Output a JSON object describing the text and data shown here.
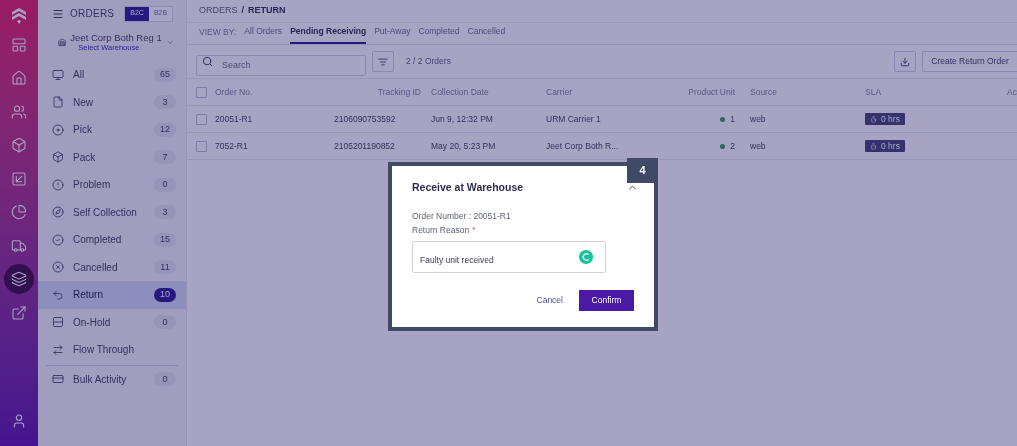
{
  "rail_items": [
    {
      "kind": "logo",
      "selected": false
    },
    {
      "kind": "layout",
      "selected": false
    },
    {
      "kind": "home",
      "selected": false
    },
    {
      "kind": "users",
      "selected": false
    },
    {
      "kind": "box",
      "selected": false
    },
    {
      "kind": "inbound",
      "selected": false
    },
    {
      "kind": "chart",
      "selected": false
    },
    {
      "kind": "truck",
      "selected": false
    },
    {
      "kind": "layers",
      "selected": true
    },
    {
      "kind": "external",
      "selected": false
    },
    {
      "kind": "user",
      "selected": false
    }
  ],
  "sidebar": {
    "title": "ORDERS",
    "segments": [
      {
        "label": "B2C",
        "selected": true
      },
      {
        "label": "B2B",
        "selected": false
      }
    ],
    "warehouse": {
      "name": "Jeet Corp Both Reg 1",
      "hint": "Select Warehouse"
    },
    "items": [
      {
        "label": "All",
        "count": "65",
        "selected": false
      },
      {
        "label": "New",
        "count": "3",
        "selected": false
      },
      {
        "label": "Pick",
        "count": "12",
        "selected": false
      },
      {
        "label": "Pack",
        "count": "7",
        "selected": false
      },
      {
        "label": "Problem",
        "count": "0",
        "selected": false
      },
      {
        "label": "Self Collection",
        "count": "3",
        "selected": false
      },
      {
        "label": "Completed",
        "count": "15",
        "selected": false
      },
      {
        "label": "Cancelled",
        "count": "11",
        "selected": false
      },
      {
        "label": "Return",
        "count": "10",
        "selected": true
      },
      {
        "label": "On-Hold",
        "count": "0",
        "selected": false
      },
      {
        "label": "Flow Through",
        "selected": false
      }
    ],
    "bottom_items": [
      {
        "label": "Bulk Activity",
        "count": "0",
        "selected": false
      }
    ]
  },
  "breadcrumb": [
    "ORDERS",
    "/",
    "RETURN"
  ],
  "view_by": {
    "label": "VIEW BY:",
    "tabs": [
      {
        "label": "All Orders",
        "selected": false
      },
      {
        "label": "Pending Receiving",
        "selected": true
      },
      {
        "label": "Put-Away",
        "selected": false
      },
      {
        "label": "Completed",
        "selected": false
      },
      {
        "label": "Cancelled",
        "selected": false
      }
    ]
  },
  "toolbar": {
    "search": {
      "placeholder": "Search"
    },
    "count": "2 / 2 Orders",
    "create_button": "Create Return Order"
  },
  "table": {
    "all_checked": false,
    "columns": [
      "Order No.",
      "Tracking ID",
      "Collection Date",
      "Carrier",
      "Product Unit",
      "Source",
      "SLA",
      "Ac"
    ],
    "rows": [
      {
        "checked": false,
        "order": "20051-R1",
        "tracking": "2106090753592",
        "date": "Jun 9, 12:32 PM",
        "carrier": "URM Carrier 1",
        "unit": "1",
        "source": "web",
        "sla": "0 hrs"
      },
      {
        "checked": false,
        "order": "7052-R1",
        "tracking": "2105201190852",
        "date": "May 20, 5:23 PM",
        "carrier": "Jeet Corp Both R...",
        "unit": "2",
        "source": "web",
        "sla": "0 hrs"
      }
    ]
  },
  "dialog": {
    "title": "Receive at Warehouse",
    "order_number": "Order Number : 20051-R1",
    "reason_label": "Return Reason",
    "required_mark": "*",
    "reason_value": "Faulty unit received",
    "cancel": "Cancel",
    "confirm": "Confirm"
  },
  "step_badge": "4"
}
